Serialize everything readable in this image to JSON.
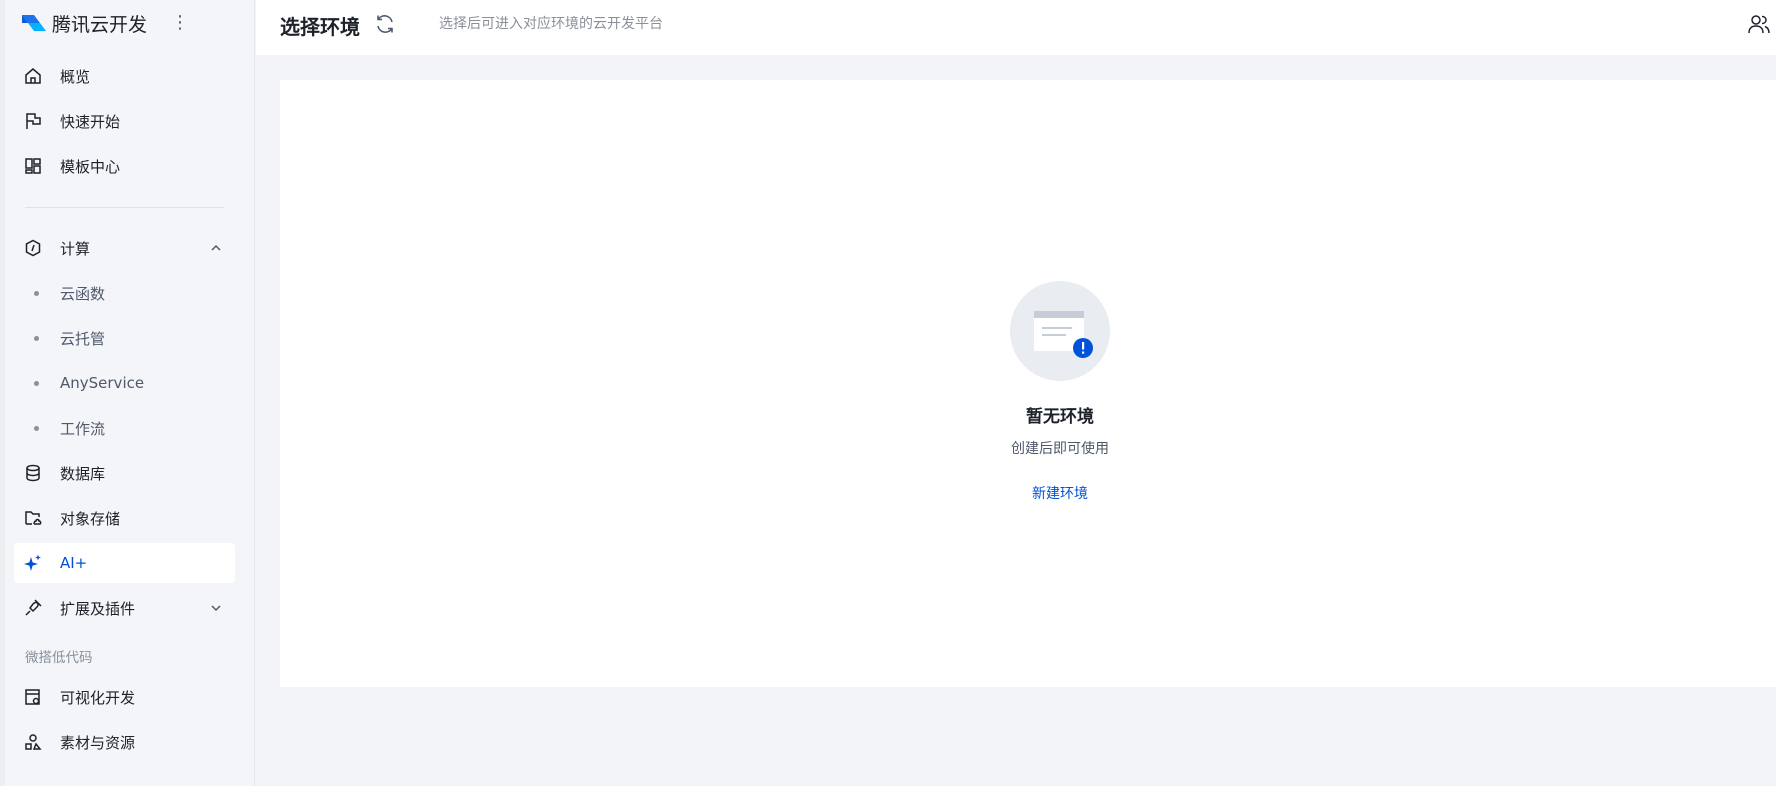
{
  "sidebar": {
    "brand": "腾讯云开发",
    "items": [
      {
        "label": "概览",
        "icon": "home-icon"
      },
      {
        "label": "快速开始",
        "icon": "flag-icon"
      },
      {
        "label": "模板中心",
        "icon": "grid-icon"
      }
    ],
    "compute": {
      "label": "计算",
      "icon": "compute-icon",
      "expanded": true,
      "children": [
        "云函数",
        "云托管",
        "AnyService",
        "工作流"
      ]
    },
    "database": "数据库",
    "storage": "对象存储",
    "ai": "AI+",
    "extensions": "扩展及插件",
    "lowcode_section": "微搭低代码",
    "visual_dev": "可视化开发",
    "assets": "素材与资源",
    "active": "AI+"
  },
  "header": {
    "title": "选择环境",
    "hint": "选择后可进入对应环境的云开发平台"
  },
  "empty": {
    "title": "暂无环境",
    "desc": "创建后即可使用",
    "action": "新建环境"
  },
  "colors": {
    "accent": "#0052d9",
    "sidebar_bg": "#f4f5f8",
    "page_bg": "#f3f4f7"
  }
}
